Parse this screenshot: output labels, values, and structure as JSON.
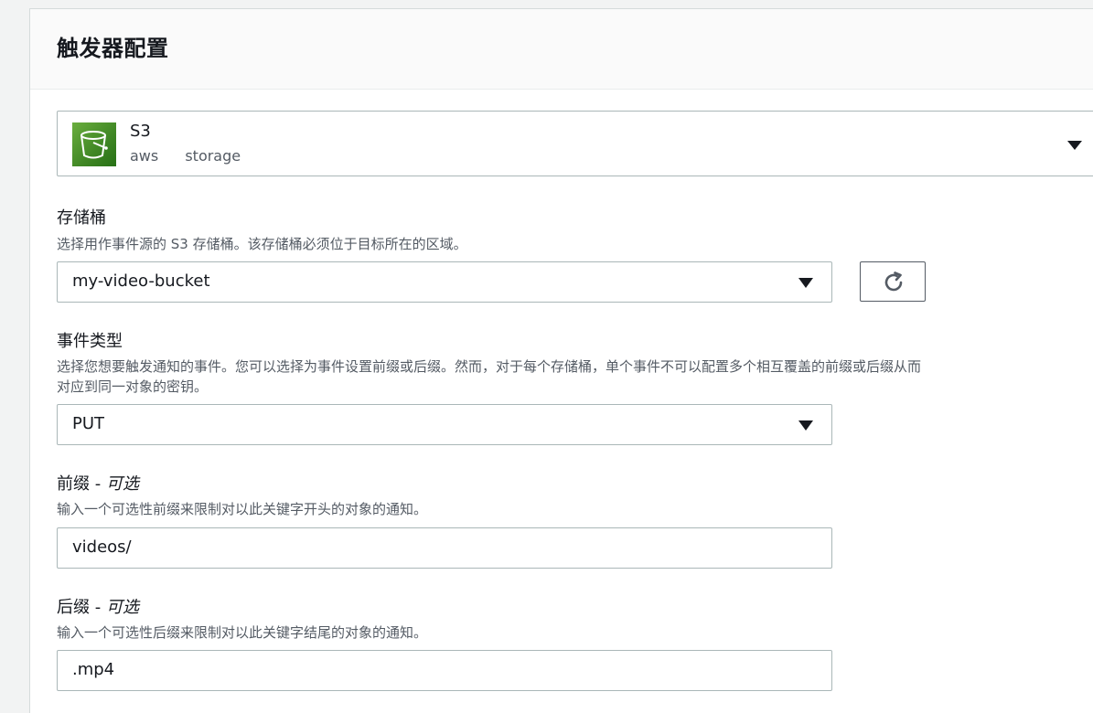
{
  "panel": {
    "title": "触发器配置"
  },
  "trigger": {
    "name": "S3",
    "tags": [
      "aws",
      "storage"
    ],
    "icon": "s3-bucket-icon"
  },
  "bucket": {
    "label": "存储桶",
    "description": "选择用作事件源的 S3 存储桶。该存储桶必须位于目标所在的区域。",
    "value": "my-video-bucket"
  },
  "event_type": {
    "label": "事件类型",
    "description_line1": "选择您想要触发通知的事件。您可以选择为事件设置前缀或后缀。然而，对于每个存储桶，单个事件不可以配置多个相互覆盖的前缀或后缀从而",
    "description_line2": "对应到同一对象的密钥。",
    "value": "PUT"
  },
  "prefix": {
    "label": "前缀",
    "separator": " - ",
    "optional": "可选",
    "description": "输入一个可选性前缀来限制对以此关键字开头的对象的通知。",
    "value": "videos/"
  },
  "suffix": {
    "label": "后缀",
    "separator": " - ",
    "optional": "可选",
    "description": "输入一个可选性后缀来限制对以此关键字结尾的对象的通知。",
    "value": ".mp4"
  },
  "colors": {
    "s3_green": "#3f8624",
    "border": "#aab7b8",
    "muted_text": "#545b64"
  }
}
